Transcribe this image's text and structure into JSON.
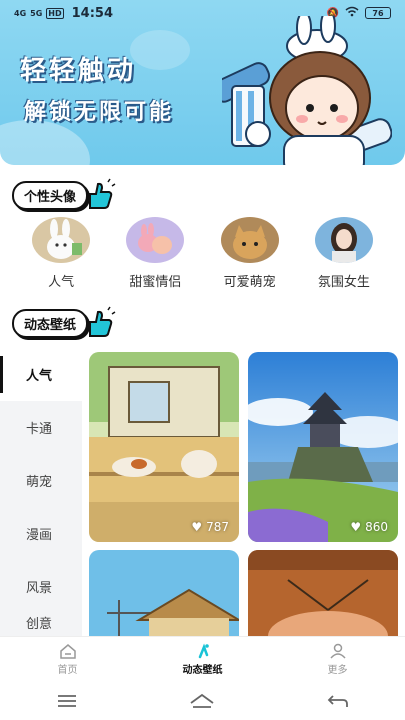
{
  "status_bar": {
    "signal1": "4G",
    "signal2": "5G",
    "hd": "HD",
    "time": "14:54",
    "battery": "76"
  },
  "banner": {
    "line1": "轻轻触动",
    "line2": "解锁无限可能"
  },
  "avatar_section": {
    "title": "个性头像",
    "items": [
      {
        "label": "人气"
      },
      {
        "label": "甜蜜情侣"
      },
      {
        "label": "可爱萌宠"
      },
      {
        "label": "氛围女生"
      }
    ]
  },
  "wallpaper_section": {
    "title": "动态壁纸",
    "categories": [
      "人气",
      "卡通",
      "萌宠",
      "漫画",
      "风景",
      "创意"
    ],
    "active_category": "人气",
    "cards": [
      {
        "likes": "787"
      },
      {
        "likes": "860"
      }
    ]
  },
  "bottom_nav": {
    "items": [
      {
        "label": "首页",
        "icon": "home-icon"
      },
      {
        "label": "动态壁纸",
        "icon": "wallpaper-icon"
      },
      {
        "label": "更多",
        "icon": "user-icon"
      }
    ],
    "active": "动态壁纸"
  },
  "colors": {
    "banner": "#7fd0ef",
    "accent": "#19c3d6",
    "active_text": "#111111"
  }
}
